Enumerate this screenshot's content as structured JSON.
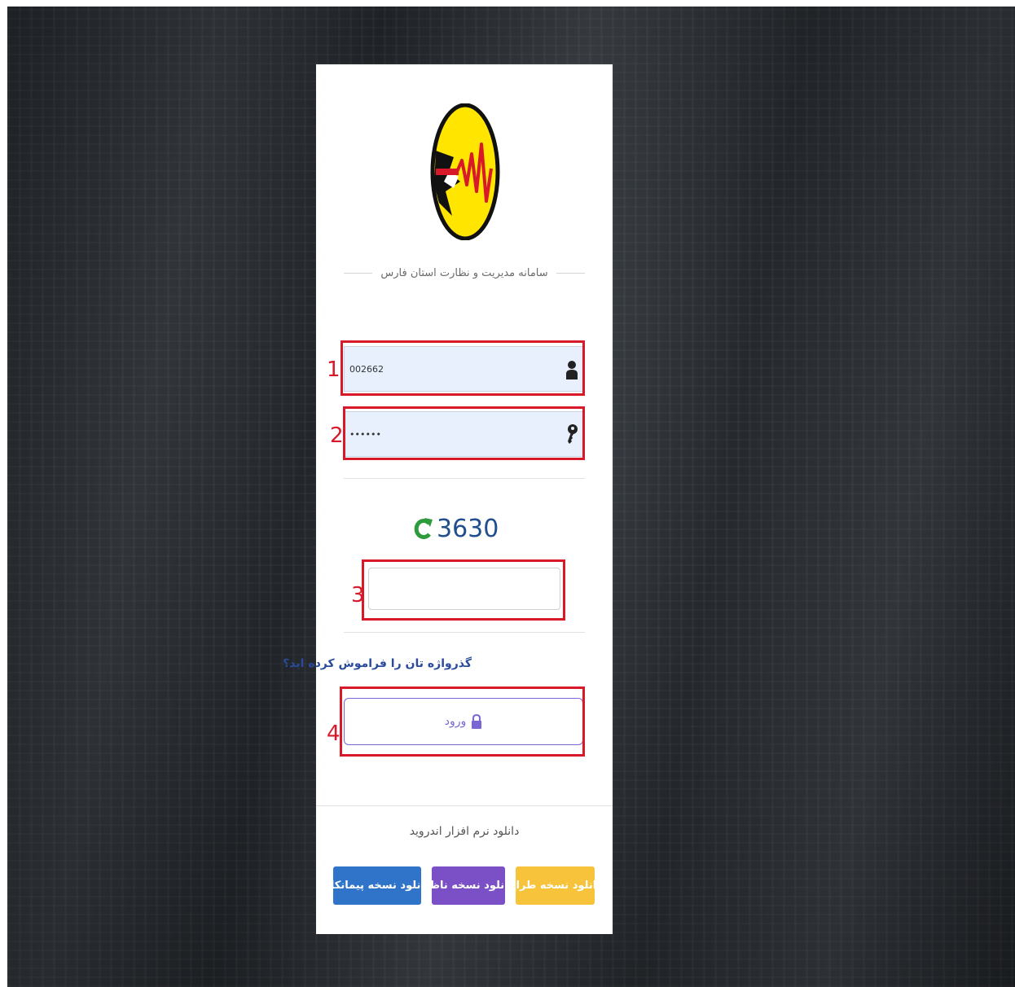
{
  "page": {
    "system_title": "سامانه مدیریت و نظارت استان فارس"
  },
  "login": {
    "username_value": "002662",
    "password_value": "••••••",
    "captcha_code": "3630",
    "captcha_input_value": "",
    "forgot_password": "گذرواژه تان را فراموش کرده اید؟",
    "login_label": "ورود"
  },
  "annotations": {
    "n1": "1",
    "n2": "2",
    "n3": "3",
    "n4": "4"
  },
  "downloads": {
    "heading": "دانلود نرم افزار اندروید",
    "buttons": [
      {
        "label": "دانلود نسخه طراح",
        "color": "#f6c33a"
      },
      {
        "label": "دانلود نسخه ناظر",
        "color": "#7b4fc5"
      },
      {
        "label": "دانلود نسخه پیمانکار",
        "color": "#2f74c9"
      }
    ]
  },
  "colors": {
    "annotation_red": "#d7192a",
    "logo_yellow": "#ffe500",
    "captcha_green": "#2e9b3c",
    "captcha_blue": "#1f4f8f"
  },
  "icons": {
    "username": "user-icon",
    "password": "key-icon",
    "captcha_refresh": "refresh-icon",
    "login": "lock-icon"
  }
}
